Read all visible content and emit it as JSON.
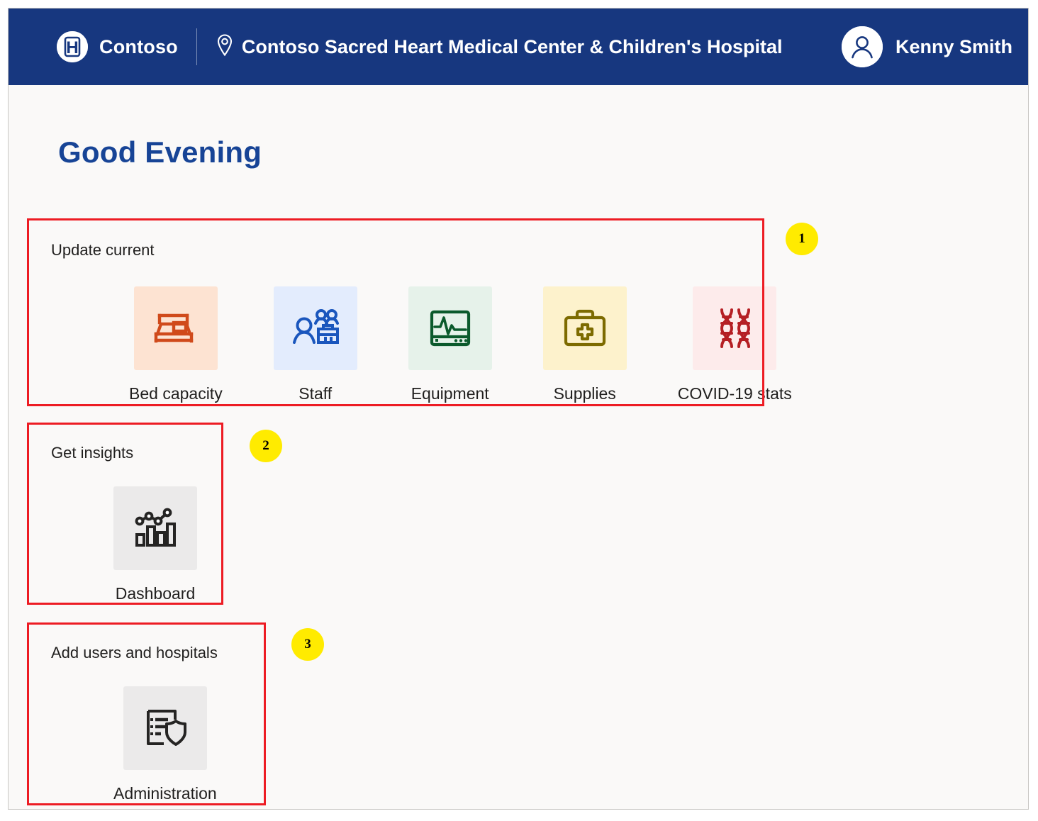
{
  "header": {
    "brand": "Contoso",
    "brand_logo_letter": "H",
    "site_name": "Contoso Sacred Heart Medical Center & Children's Hospital",
    "user_name": "Kenny Smith",
    "background_color": "#17377f",
    "location_icon": "map-pin-icon",
    "avatar_icon": "person-icon"
  },
  "page": {
    "greeting": "Good Evening",
    "greeting_color": "#174496",
    "background_color": "#faf9f8"
  },
  "sections": [
    {
      "title": "Update current",
      "tiles": [
        {
          "label": "Bed capacity",
          "icon": "bed-icon",
          "icon_color": "#d04a1b",
          "tile_color": "#fde3d2"
        },
        {
          "label": "Staff",
          "icon": "people-work-icon",
          "icon_color": "#1a56bd",
          "tile_color": "#e3ecfd"
        },
        {
          "label": "Equipment",
          "icon": "monitor-vitals-icon",
          "icon_color": "#0b5a2c",
          "tile_color": "#e6f2ea"
        },
        {
          "label": "Supplies",
          "icon": "medical-kit-icon",
          "icon_color": "#7d6b00",
          "tile_color": "#fdf2cc"
        },
        {
          "label": "COVID-19 stats",
          "icon": "dna-icon",
          "icon_color": "#b51f24",
          "tile_color": "#fdebeb"
        }
      ]
    },
    {
      "title": "Get insights",
      "tiles": [
        {
          "label": "Dashboard",
          "icon": "bar-chart-trend-icon",
          "icon_color": "#252423",
          "tile_color": "#ebeaea"
        }
      ]
    },
    {
      "title": "Add users and hospitals",
      "tiles": [
        {
          "label": "Administration",
          "icon": "document-shield-icon",
          "icon_color": "#252423",
          "tile_color": "#ebeaea"
        }
      ]
    }
  ],
  "annotations": {
    "box_color": "#ed1c24",
    "badge_color": "#ffeb00",
    "badges": [
      {
        "number": "1"
      },
      {
        "number": "2"
      },
      {
        "number": "3"
      }
    ]
  }
}
